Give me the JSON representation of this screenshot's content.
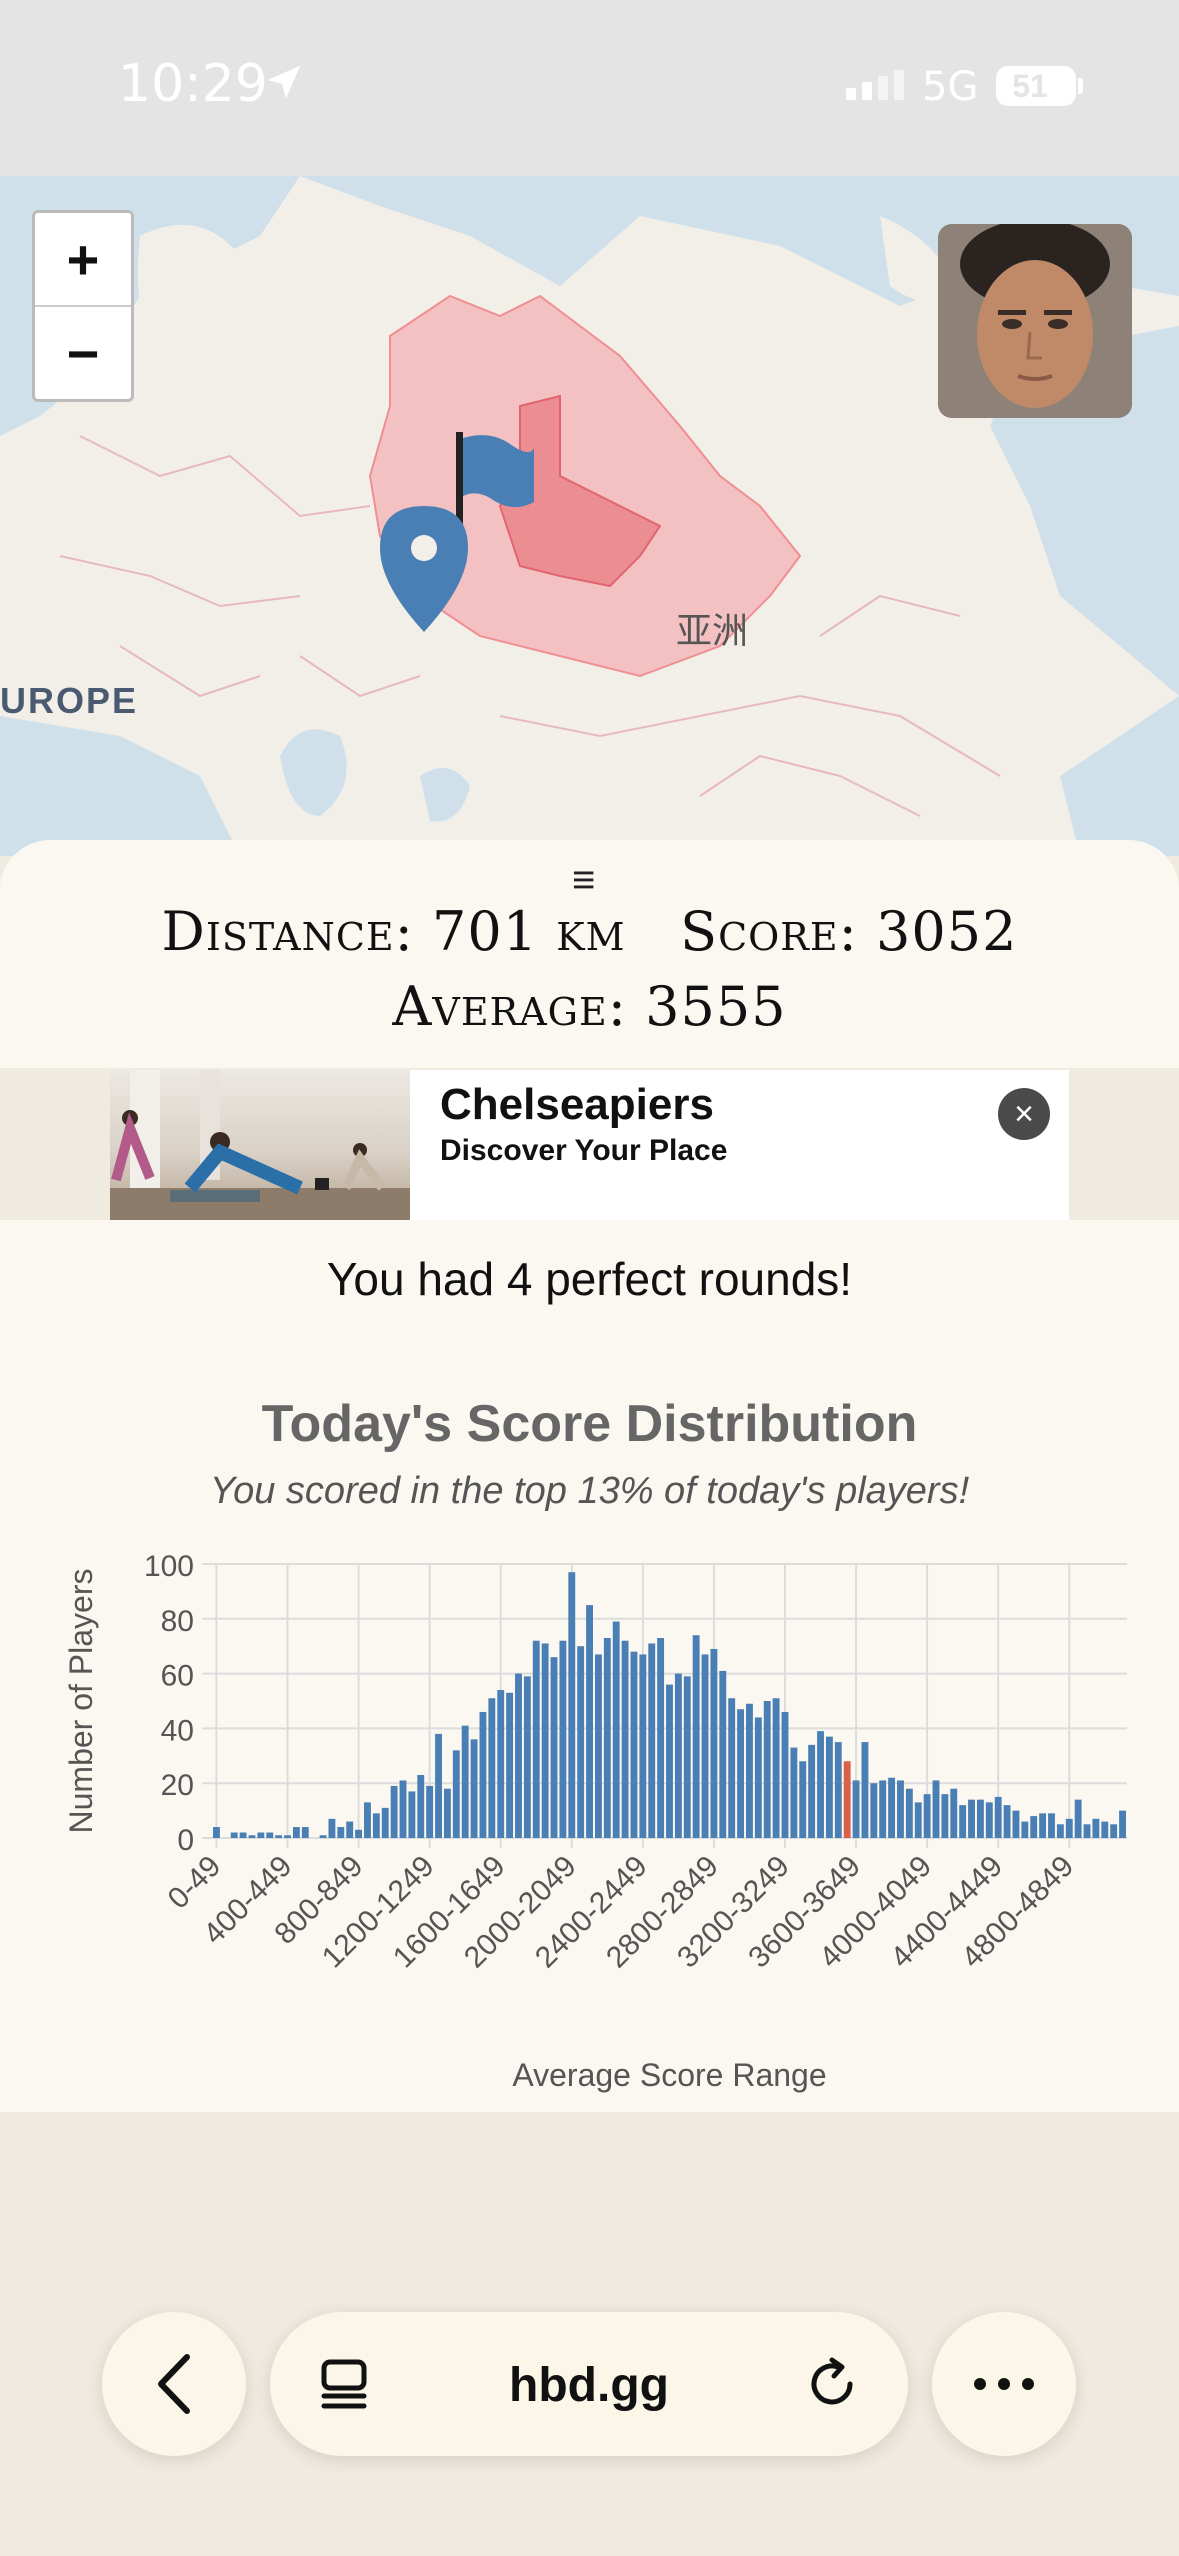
{
  "status_bar": {
    "time": "10:29",
    "network": "5G",
    "battery": "51"
  },
  "map": {
    "zoom_in": "+",
    "zoom_out": "−",
    "label_europe": "UROPE",
    "label_asia": "亚洲"
  },
  "results": {
    "distance_label": "Distance:",
    "distance_value": "701 km",
    "score_label": "Score:",
    "score_value": "3052",
    "average_label": "Average:",
    "average_value": "3555"
  },
  "ad": {
    "title": "Chelseapiers",
    "subtitle": "Discover Your Place",
    "close_icon": "×"
  },
  "perfect_rounds": "You had 4 perfect rounds!",
  "chart_data": {
    "type": "bar",
    "title": "Today's Score Distribution",
    "subtitle": "You scored in the top 13% of today's players!",
    "xlabel": "Average Score Range",
    "ylabel": "Number of Players",
    "ylim": [
      0,
      100
    ],
    "yticks": [
      0,
      20,
      40,
      60,
      80,
      100
    ],
    "bin_width": 50,
    "xtick_labels": [
      "0-49",
      "400-449",
      "800-849",
      "1200-1249",
      "1600-1649",
      "2000-2049",
      "2400-2449",
      "2800-2849",
      "3200-3249",
      "3600-3649",
      "4000-4049",
      "4400-4449",
      "4800-4849"
    ],
    "values": [
      4,
      0,
      2,
      2,
      1,
      2,
      2,
      1,
      1,
      4,
      4,
      0,
      1,
      7,
      4,
      6,
      3,
      13,
      9,
      11,
      19,
      21,
      17,
      23,
      19,
      38,
      18,
      32,
      41,
      36,
      46,
      51,
      54,
      53,
      60,
      59,
      72,
      71,
      66,
      72,
      97,
      70,
      85,
      67,
      73,
      79,
      72,
      68,
      67,
      71,
      73,
      56,
      60,
      59,
      74,
      67,
      69,
      61,
      51,
      47,
      49,
      44,
      50,
      51,
      46,
      33,
      28,
      34,
      39,
      37,
      35,
      28,
      21,
      35,
      20,
      21,
      22,
      21,
      18,
      13,
      16,
      21,
      16,
      18,
      12,
      14,
      14,
      13,
      15,
      12,
      10,
      6,
      8,
      9,
      9,
      5,
      7,
      14,
      5,
      7,
      6,
      5,
      10
    ],
    "highlight_index": 71,
    "bar_color": "#4a7fb5",
    "highlight_color": "#d9604a"
  },
  "browser": {
    "url": "hbd.gg"
  }
}
